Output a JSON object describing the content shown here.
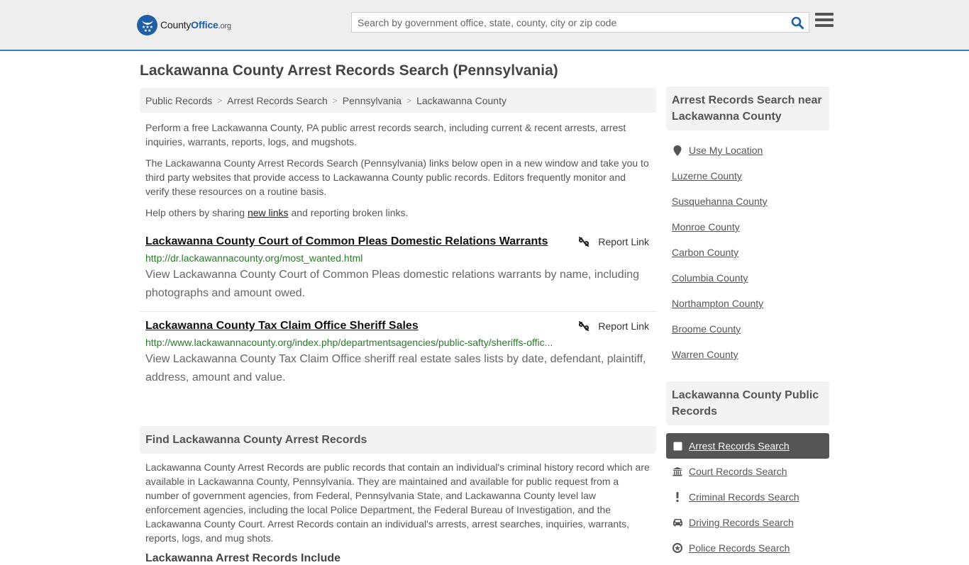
{
  "header": {
    "logo": {
      "brand_prefix": "County",
      "brand_main": "Office",
      "brand_suffix": ".org"
    },
    "search": {
      "placeholder": "Search by government office, state, county, city or zip code",
      "value": ""
    },
    "icons": {
      "search": "search-icon",
      "menu": "hamburger-menu-icon"
    }
  },
  "page": {
    "title": "Lackawanna County Arrest Records Search (Pennsylvania)"
  },
  "breadcrumb": {
    "items": [
      "Public Records",
      "Arrest Records Search",
      "Pennsylvania",
      "Lackawanna County"
    ],
    "separator": ">"
  },
  "intro": {
    "p1": "Perform a free Lackawanna County, PA public arrest records search, including current & recent arrests, arrest inquiries, warrants, reports, logs, and mugshots.",
    "p2": "The Lackawanna County Arrest Records Search (Pennsylvania) links below open in a new window and take you to third party websites that provide access to Lackawanna County public records. Editors frequently monitor and verify these resources on a routine basis.",
    "p3_before": "Help others by sharing ",
    "p3_link": "new links",
    "p3_after": " and reporting broken links."
  },
  "results": [
    {
      "title": "Lackawanna County Court of Common Pleas Domestic Relations Warrants",
      "url": "http://dr.lackawannacounty.org/most_wanted.html",
      "description": "View Lackawanna County Court of Common Pleas domestic relations warrants by name, including photographs and amount owed.",
      "report_label": "Report Link"
    },
    {
      "title": "Lackawanna County Tax Claim Office Sheriff Sales",
      "url": "http://www.lackawannacounty.org/index.php/departmentsagencies/public-safty/sheriffs-offic...",
      "description": "View Lackawanna County Tax Claim Office sheriff real estate sales lists by date, defendant, plaintiff, address, amount and value.",
      "report_label": "Report Link"
    }
  ],
  "find_section": {
    "heading": "Find Lackawanna County Arrest Records",
    "body": "Lackawanna County Arrest Records are public records that contain an individual's criminal history record which are available in Lackawanna County, Pennsylvania. They are maintained and available for public request from a number of government agencies, from Federal, Pennsylvania State, and Lackawanna County level law enforcement agencies, including the local Police Department, the Federal Bureau of Investigation, and the Lackawanna County Court. Arrest Records contain an individual's arrests, arrest searches, inquiries, warrants, reports, logs, and mug shots.",
    "next_heading_partial": "Lackawanna Arrest Records Include"
  },
  "sidebar": {
    "nearby": {
      "heading": "Arrest Records Search near Lackawanna County",
      "use_location": "Use My Location",
      "counties": [
        "Luzerne County",
        "Susquehanna County",
        "Monroe County",
        "Carbon County",
        "Columbia County",
        "Northampton County",
        "Broome County",
        "Warren County"
      ]
    },
    "public_records": {
      "heading": "Lackawanna County Public Records",
      "items": [
        {
          "label": "Arrest Records Search",
          "icon": "square-icon",
          "active": true
        },
        {
          "label": "Court Records Search",
          "icon": "courthouse-icon",
          "active": false
        },
        {
          "label": "Criminal Records Search",
          "icon": "exclamation-icon",
          "active": false
        },
        {
          "label": "Driving Records Search",
          "icon": "car-icon",
          "active": false
        },
        {
          "label": "Police Records Search",
          "icon": "police-badge-icon",
          "active": false
        }
      ]
    }
  },
  "colors": {
    "brand_blue": "#1f5fa6",
    "header_border": "#3a7cb0",
    "url_green": "#2a7a2a",
    "active_item": "#555555"
  }
}
